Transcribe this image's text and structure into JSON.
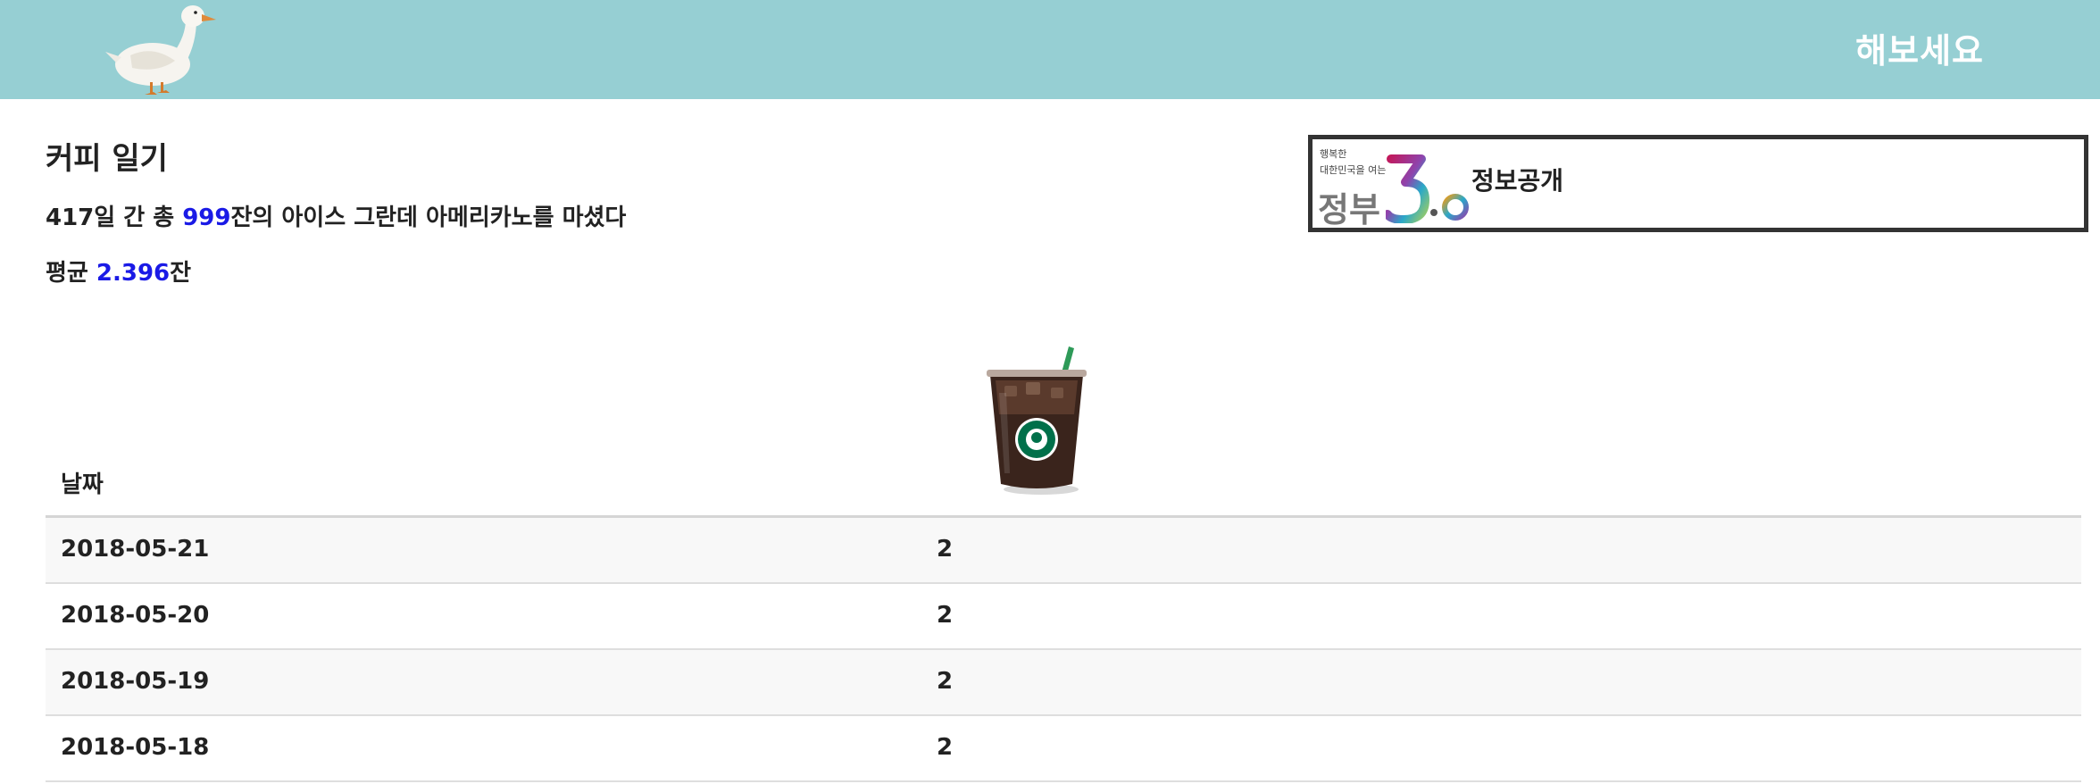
{
  "header": {
    "try_label": "해보세요"
  },
  "summary": {
    "title": "커피 일기",
    "days": "417",
    "days_suffix": "일 간 총 ",
    "cups": "999",
    "cups_suffix": "잔의 아이스 그란데 아메리카노를 마셨다",
    "average_prefix": "평균 ",
    "average": "2.396",
    "average_suffix": "잔"
  },
  "gov_banner": {
    "small_line1": "행복한",
    "small_line2": "대한민국을 여는",
    "big": "정부",
    "version": "3.0",
    "label": "정보공개"
  },
  "table": {
    "date_header": "날짜",
    "rows": [
      {
        "date": "2018-05-21",
        "count": "2"
      },
      {
        "date": "2018-05-20",
        "count": "2"
      },
      {
        "date": "2018-05-19",
        "count": "2"
      },
      {
        "date": "2018-05-18",
        "count": "2"
      }
    ]
  },
  "colors": {
    "header_bg": "#96cfd3",
    "number_accent": "#1a1ae6",
    "row_stripe": "#f8f8f8"
  },
  "icons": {
    "logo": "duck-icon",
    "cup_column": "iced-coffee-cup-icon",
    "gov_logo": "gov-3.0-logo"
  }
}
